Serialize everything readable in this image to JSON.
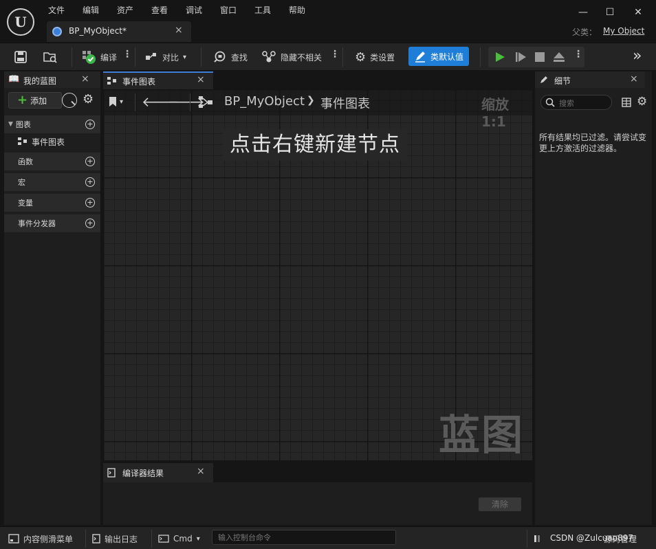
{
  "menu": [
    "文件",
    "编辑",
    "资产",
    "查看",
    "调试",
    "窗口",
    "工具",
    "帮助"
  ],
  "document_tab": {
    "label": "BP_MyObject*",
    "close": "×"
  },
  "window_controls": {
    "minimize": "—",
    "maximize": "☐",
    "close": "✕"
  },
  "parent_class": {
    "label": "父类：",
    "value": "My Object"
  },
  "toolbar": {
    "compile": "编译",
    "diff": "对比",
    "find": "查找",
    "hide_unrelated": "隐藏不相关",
    "class_settings": "类设置",
    "class_defaults": "类默认值",
    "more": "»"
  },
  "my_blueprint": {
    "tab_label": "我的蓝图",
    "close": "×",
    "add_button": "添加",
    "categories": [
      {
        "label": "图表",
        "items": [
          "事件图表"
        ]
      },
      {
        "label": "函数"
      },
      {
        "label": "宏"
      },
      {
        "label": "变量"
      },
      {
        "label": "事件分发器"
      }
    ]
  },
  "graph": {
    "tab_label": "事件图表",
    "close": "×",
    "breadcrumb_root": "BP_MyObject",
    "breadcrumb_sep": "❯",
    "breadcrumb_current": "事件图表",
    "zoom": "缩放1:1",
    "hint": "点击右键新建节点",
    "watermark": "蓝图"
  },
  "compiler_results": {
    "tab_label": "编译器结果",
    "close": "×",
    "clear_button": "清除"
  },
  "details": {
    "tab_label": "细节",
    "close": "×",
    "search_placeholder": "搜索",
    "message": "所有结果均已过滤。请尝试变更上方激活的过滤器。"
  },
  "statusbar": {
    "content_drawer": "内容侧滑菜单",
    "output_log": "输出日志",
    "cmd": "Cmd",
    "console_placeholder": "输入控制台命令",
    "source_control": "源码管理",
    "overlay_text": "CSDN @Zulcuao897"
  },
  "colors": {
    "accent_blue": "#1f7fd8",
    "play_green": "#4cbc3c",
    "compile_ok_green": "#3cb64a"
  }
}
